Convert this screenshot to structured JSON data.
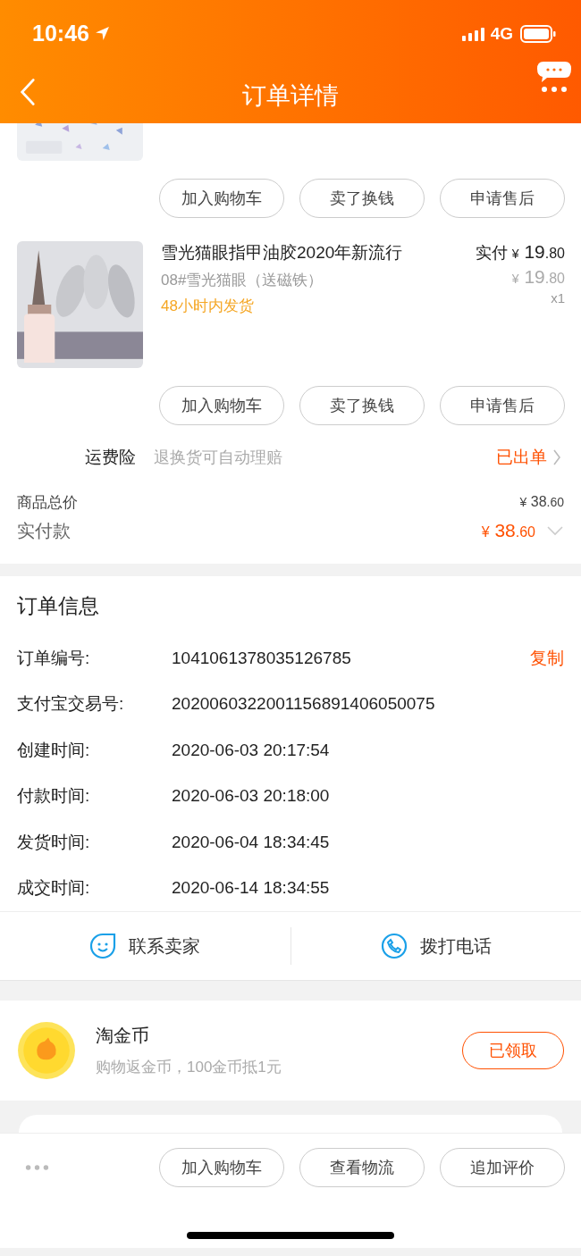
{
  "status_bar": {
    "time": "10:46",
    "network": "4G"
  },
  "nav": {
    "title": "订单详情"
  },
  "items": [
    {
      "kind": "cut",
      "actions": [
        "加入购物车",
        "卖了换钱",
        "申请售后"
      ]
    },
    {
      "kind": "full",
      "title": "雪光猫眼指甲油胶2020年新流行",
      "paid_label": "实付",
      "paid": {
        "currency": "¥",
        "integer": "19",
        "decimal": ".80"
      },
      "spec": "08#雪光猫眼（送磁铁）",
      "price": {
        "currency": "¥",
        "integer": "19",
        "decimal": ".80"
      },
      "delivery": "48小时内发货",
      "quantity": "x1",
      "actions": [
        "加入购物车",
        "卖了换钱",
        "申请售后"
      ]
    }
  ],
  "insurance": {
    "label": "运费险",
    "description": "退换货可自动理赔",
    "status": "已出单"
  },
  "totals": {
    "goods_label": "商品总价",
    "goods": {
      "currency": "¥",
      "integer": "38",
      "decimal": ".60"
    },
    "paid_label": "实付款",
    "paid": {
      "currency": "¥",
      "integer": "38",
      "decimal": ".60"
    }
  },
  "order_info": {
    "title": "订单信息",
    "rows": [
      {
        "label": "订单编号:",
        "value": "1041061378035126785",
        "action": "复制"
      },
      {
        "label": "支付宝交易号:",
        "value": "2020060322001156891406050075"
      },
      {
        "label": "创建时间:",
        "value": "2020-06-03 20:17:54"
      },
      {
        "label": "付款时间:",
        "value": "2020-06-03 20:18:00"
      },
      {
        "label": "发货时间:",
        "value": "2020-06-04 18:34:45"
      },
      {
        "label": "成交时间:",
        "value": "2020-06-14 18:34:55"
      }
    ]
  },
  "contact": [
    {
      "kind": "chat",
      "label": "联系卖家"
    },
    {
      "kind": "phone",
      "label": "拨打电话"
    }
  ],
  "coins": {
    "title": "淘金币",
    "description": "购物返金币，100金币抵1元",
    "button": "已领取"
  },
  "bottom_bar": {
    "actions": [
      "加入购物车",
      "查看物流",
      "追加评价"
    ]
  }
}
